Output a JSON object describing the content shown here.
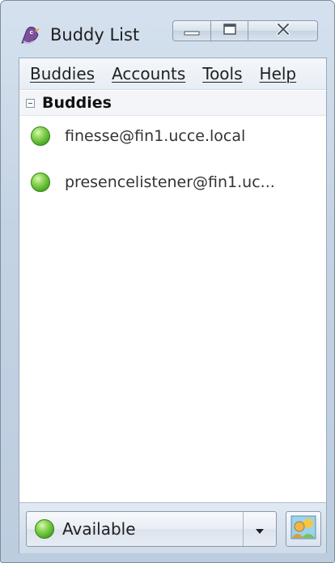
{
  "window": {
    "title": "Buddy List",
    "app_icon": "pidgin-icon",
    "controls": [
      "minimize-icon",
      "maximize-icon",
      "close-icon"
    ]
  },
  "menu": {
    "items": [
      "Buddies",
      "Accounts",
      "Tools",
      "Help"
    ]
  },
  "buddy_list": {
    "group": {
      "label": "Buddies",
      "expanded": true,
      "expander_icon": "collapse-icon"
    },
    "buddies": [
      {
        "name": "finesse@fin1.ucce.local",
        "status_icon": "available-icon"
      },
      {
        "name": "presencelistener@fin1.uc...",
        "status_icon": "available-icon"
      }
    ]
  },
  "status_bar": {
    "status": "Available",
    "status_icon": "available-icon",
    "dropdown_icon": "chevron-down-icon",
    "avatar_icon": "buddy-icon"
  },
  "colors": {
    "available": "#4aa723",
    "chrome": "#c4d3e4"
  }
}
